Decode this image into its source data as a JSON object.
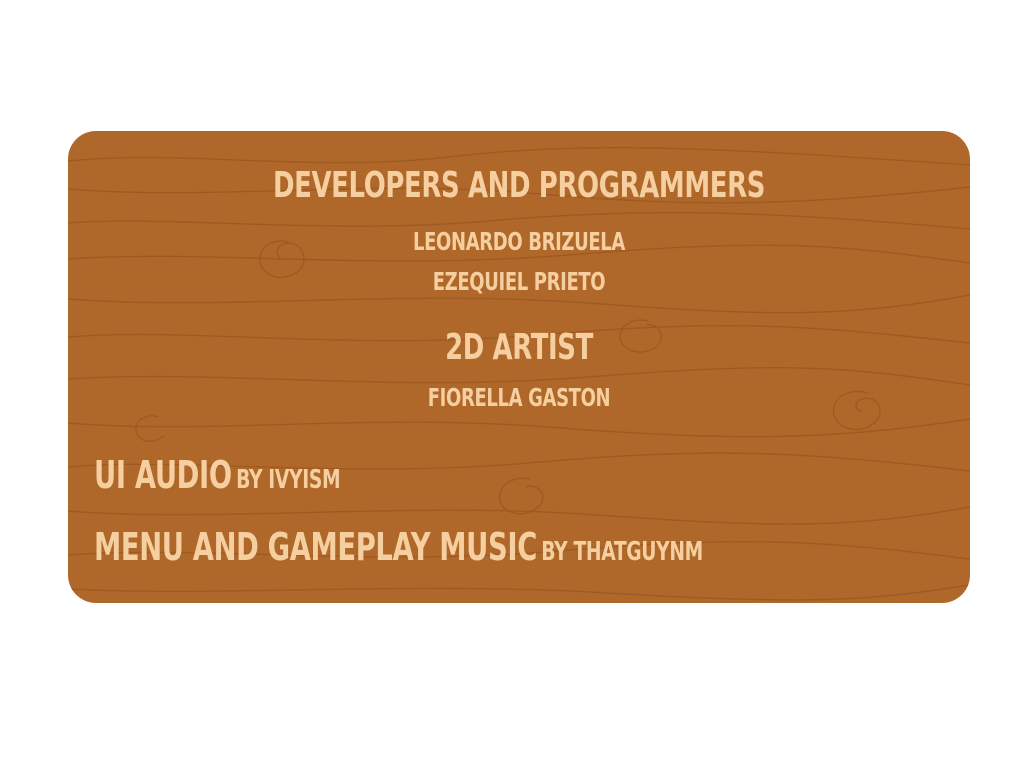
{
  "credits": {
    "developers_heading": "Developers and programmers",
    "developers": [
      "Leonardo Brizuela",
      "Ezequiel Prieto"
    ],
    "artist_heading": "2D Artist",
    "artists": [
      "Fiorella Gaston"
    ],
    "ui_audio": {
      "title": "UI Audio",
      "by": "by Ivyism"
    },
    "music": {
      "title": "Menu and gameplay music",
      "by": "by thatguynm"
    }
  },
  "colors": {
    "panel": "#b0682a",
    "grain": "#99561f",
    "text": "#f6cfa0",
    "background": "#ffffff"
  }
}
